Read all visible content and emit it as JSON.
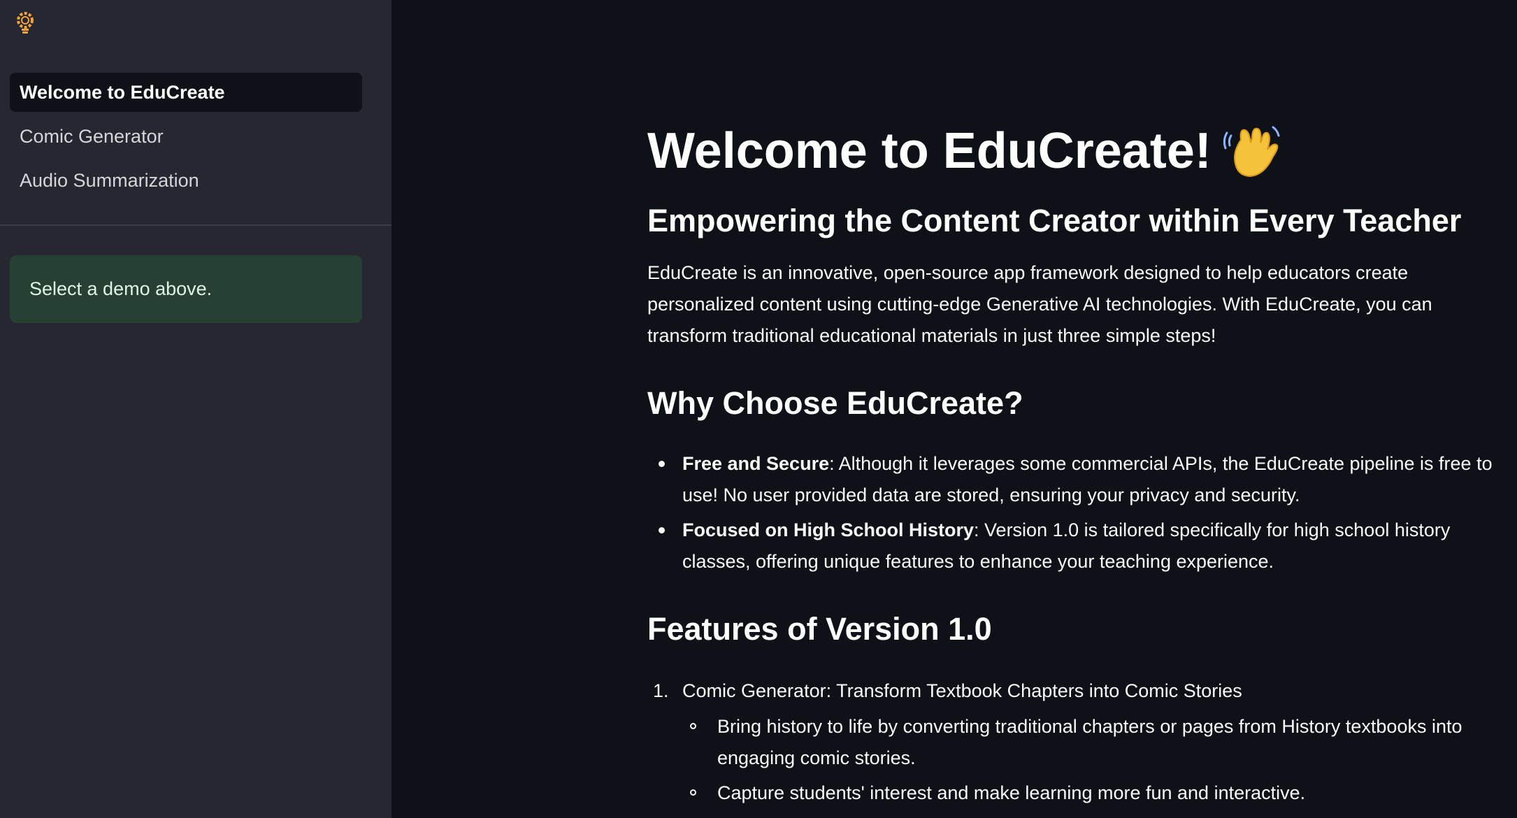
{
  "sidebar": {
    "logo_icon": "lightbulb-gear-icon",
    "nav_items": [
      {
        "label": "Welcome to EduCreate",
        "active": true
      },
      {
        "label": "Comic Generator",
        "active": false
      },
      {
        "label": "Audio Summarization",
        "active": false
      }
    ],
    "info_text": "Select a demo above."
  },
  "main": {
    "title": "Welcome to EduCreate!",
    "title_icon": "waving-hand-icon",
    "subtitle": "Empowering the Content Creator within Every Teacher",
    "intro": "EduCreate is an innovative, open-source app framework designed to help educators create personalized content using cutting-edge Generative AI technologies. With EduCreate, you can transform traditional educational materials in just three simple steps!",
    "why_heading": "Why Choose EduCreate?",
    "reasons": [
      {
        "bold": "Free and Secure",
        "text": ": Although it leverages some commercial APIs, the EduCreate pipeline is free to use! No user provided data are stored, ensuring your privacy and security."
      },
      {
        "bold": "Focused on High School History",
        "text": ": Version 1.0 is tailored specifically for high school history classes, offering unique features to enhance your teaching experience."
      }
    ],
    "features_heading": "Features of Version 1.0",
    "features": [
      {
        "number": "1.",
        "label": "Comic Generator: Transform Textbook Chapters into Comic Stories",
        "points": [
          "Bring history to life by converting traditional chapters or pages from History textbooks into engaging comic stories.",
          "Capture students' interest and make learning more fun and interactive."
        ]
      }
    ]
  },
  "colors": {
    "sidebar_bg": "#262730",
    "main_bg": "#0e1117",
    "info_bg": "#264033",
    "logo_accent": "#f2a33a"
  }
}
